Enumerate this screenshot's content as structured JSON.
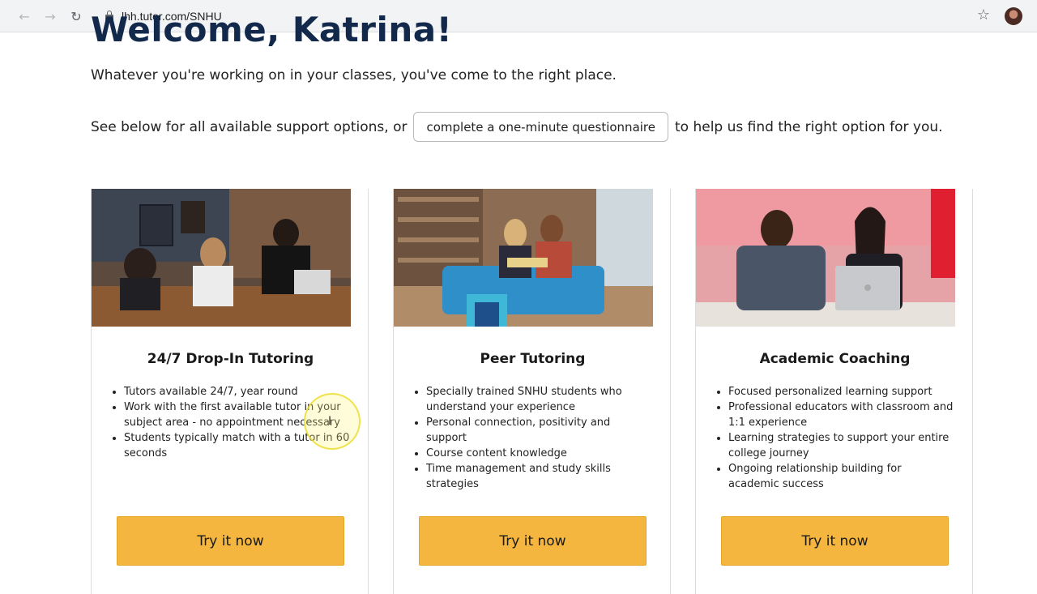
{
  "browser": {
    "url": "lhh.tutor.com/SNHU"
  },
  "page": {
    "welcome": "Welcome, Katrina!",
    "intro": "Whatever you're working on in your classes, you've come to the right place.",
    "options_prefix": "See below for all available support options, or",
    "questionnaire_button": "complete a one-minute questionnaire",
    "options_suffix": "to help us find the right option for you."
  },
  "cards": [
    {
      "title": "24/7 Drop-In Tutoring",
      "bullets": [
        "Tutors available 24/7, year round",
        "Work with the first available tutor in your subject area - no appointment necessary",
        "Students typically match with a tutor in 60 seconds"
      ],
      "button": "Try it now"
    },
    {
      "title": "Peer Tutoring",
      "bullets": [
        "Specially trained SNHU students who understand your experience",
        "Personal connection, positivity and support",
        "Course content knowledge",
        "Time management and study skills strategies"
      ],
      "button": "Try it now"
    },
    {
      "title": "Academic Coaching",
      "bullets": [
        "Focused personalized learning support",
        "Professional educators with classroom and 1:1 experience",
        "Learning strategies to support your entire college journey",
        "Ongoing relationship building for academic success"
      ],
      "button": "Try it now"
    }
  ],
  "colors": {
    "heading": "#13294b",
    "button_bg": "#f4b63f"
  }
}
